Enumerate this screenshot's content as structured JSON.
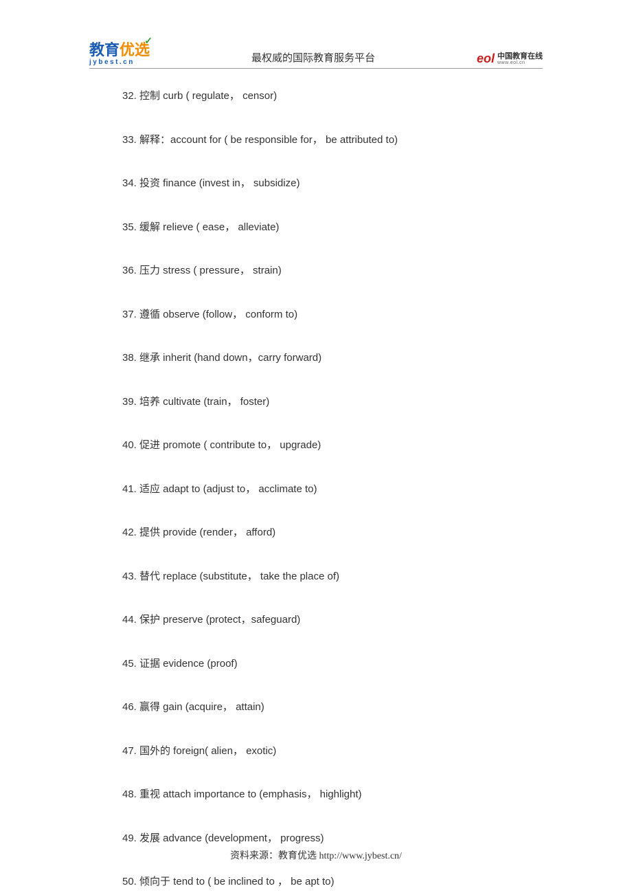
{
  "header": {
    "logo_left_main_blue": "教育",
    "logo_left_main_orange": "优选",
    "logo_left_sub": "jybest.cn",
    "title": "最权威的国际教育服务平台",
    "logo_right_mark": "eol",
    "logo_right_cn": "中国教育在线",
    "logo_right_url": "www.eol.cn"
  },
  "items": [
    "32. 控制 curb ( regulate， censor)",
    "33. 解释：account for ( be responsible for， be attributed to)",
    "34. 投资 finance (invest in， subsidize)",
    "35. 缓解 relieve ( ease， alleviate)",
    "36. 压力 stress ( pressure， strain)",
    "37. 遵循 observe (follow， conform to)",
    "38. 继承 inherit (hand down，carry forward)",
    "39. 培养 cultivate (train， foster)",
    "40. 促进 promote ( contribute to， upgrade)",
    "41. 适应 adapt to (adjust to， acclimate to)",
    "42. 提供 provide (render， afford)",
    "43. 替代 replace (substitute， take the place of)",
    "44. 保护 preserve (protect，safeguard)",
    "45. 证据 evidence (proof)",
    "46. 赢得 gain (acquire， attain)",
    "47. 国外的 foreign( alien， exotic)",
    "48. 重视 attach importance to (emphasis， highlight)",
    "49. 发展 advance (development， progress)",
    "50. 倾向于 tend to ( be inclined to ， be apt to)"
  ],
  "footer": "资料来源：教育优选 http://www.jybest.cn/"
}
